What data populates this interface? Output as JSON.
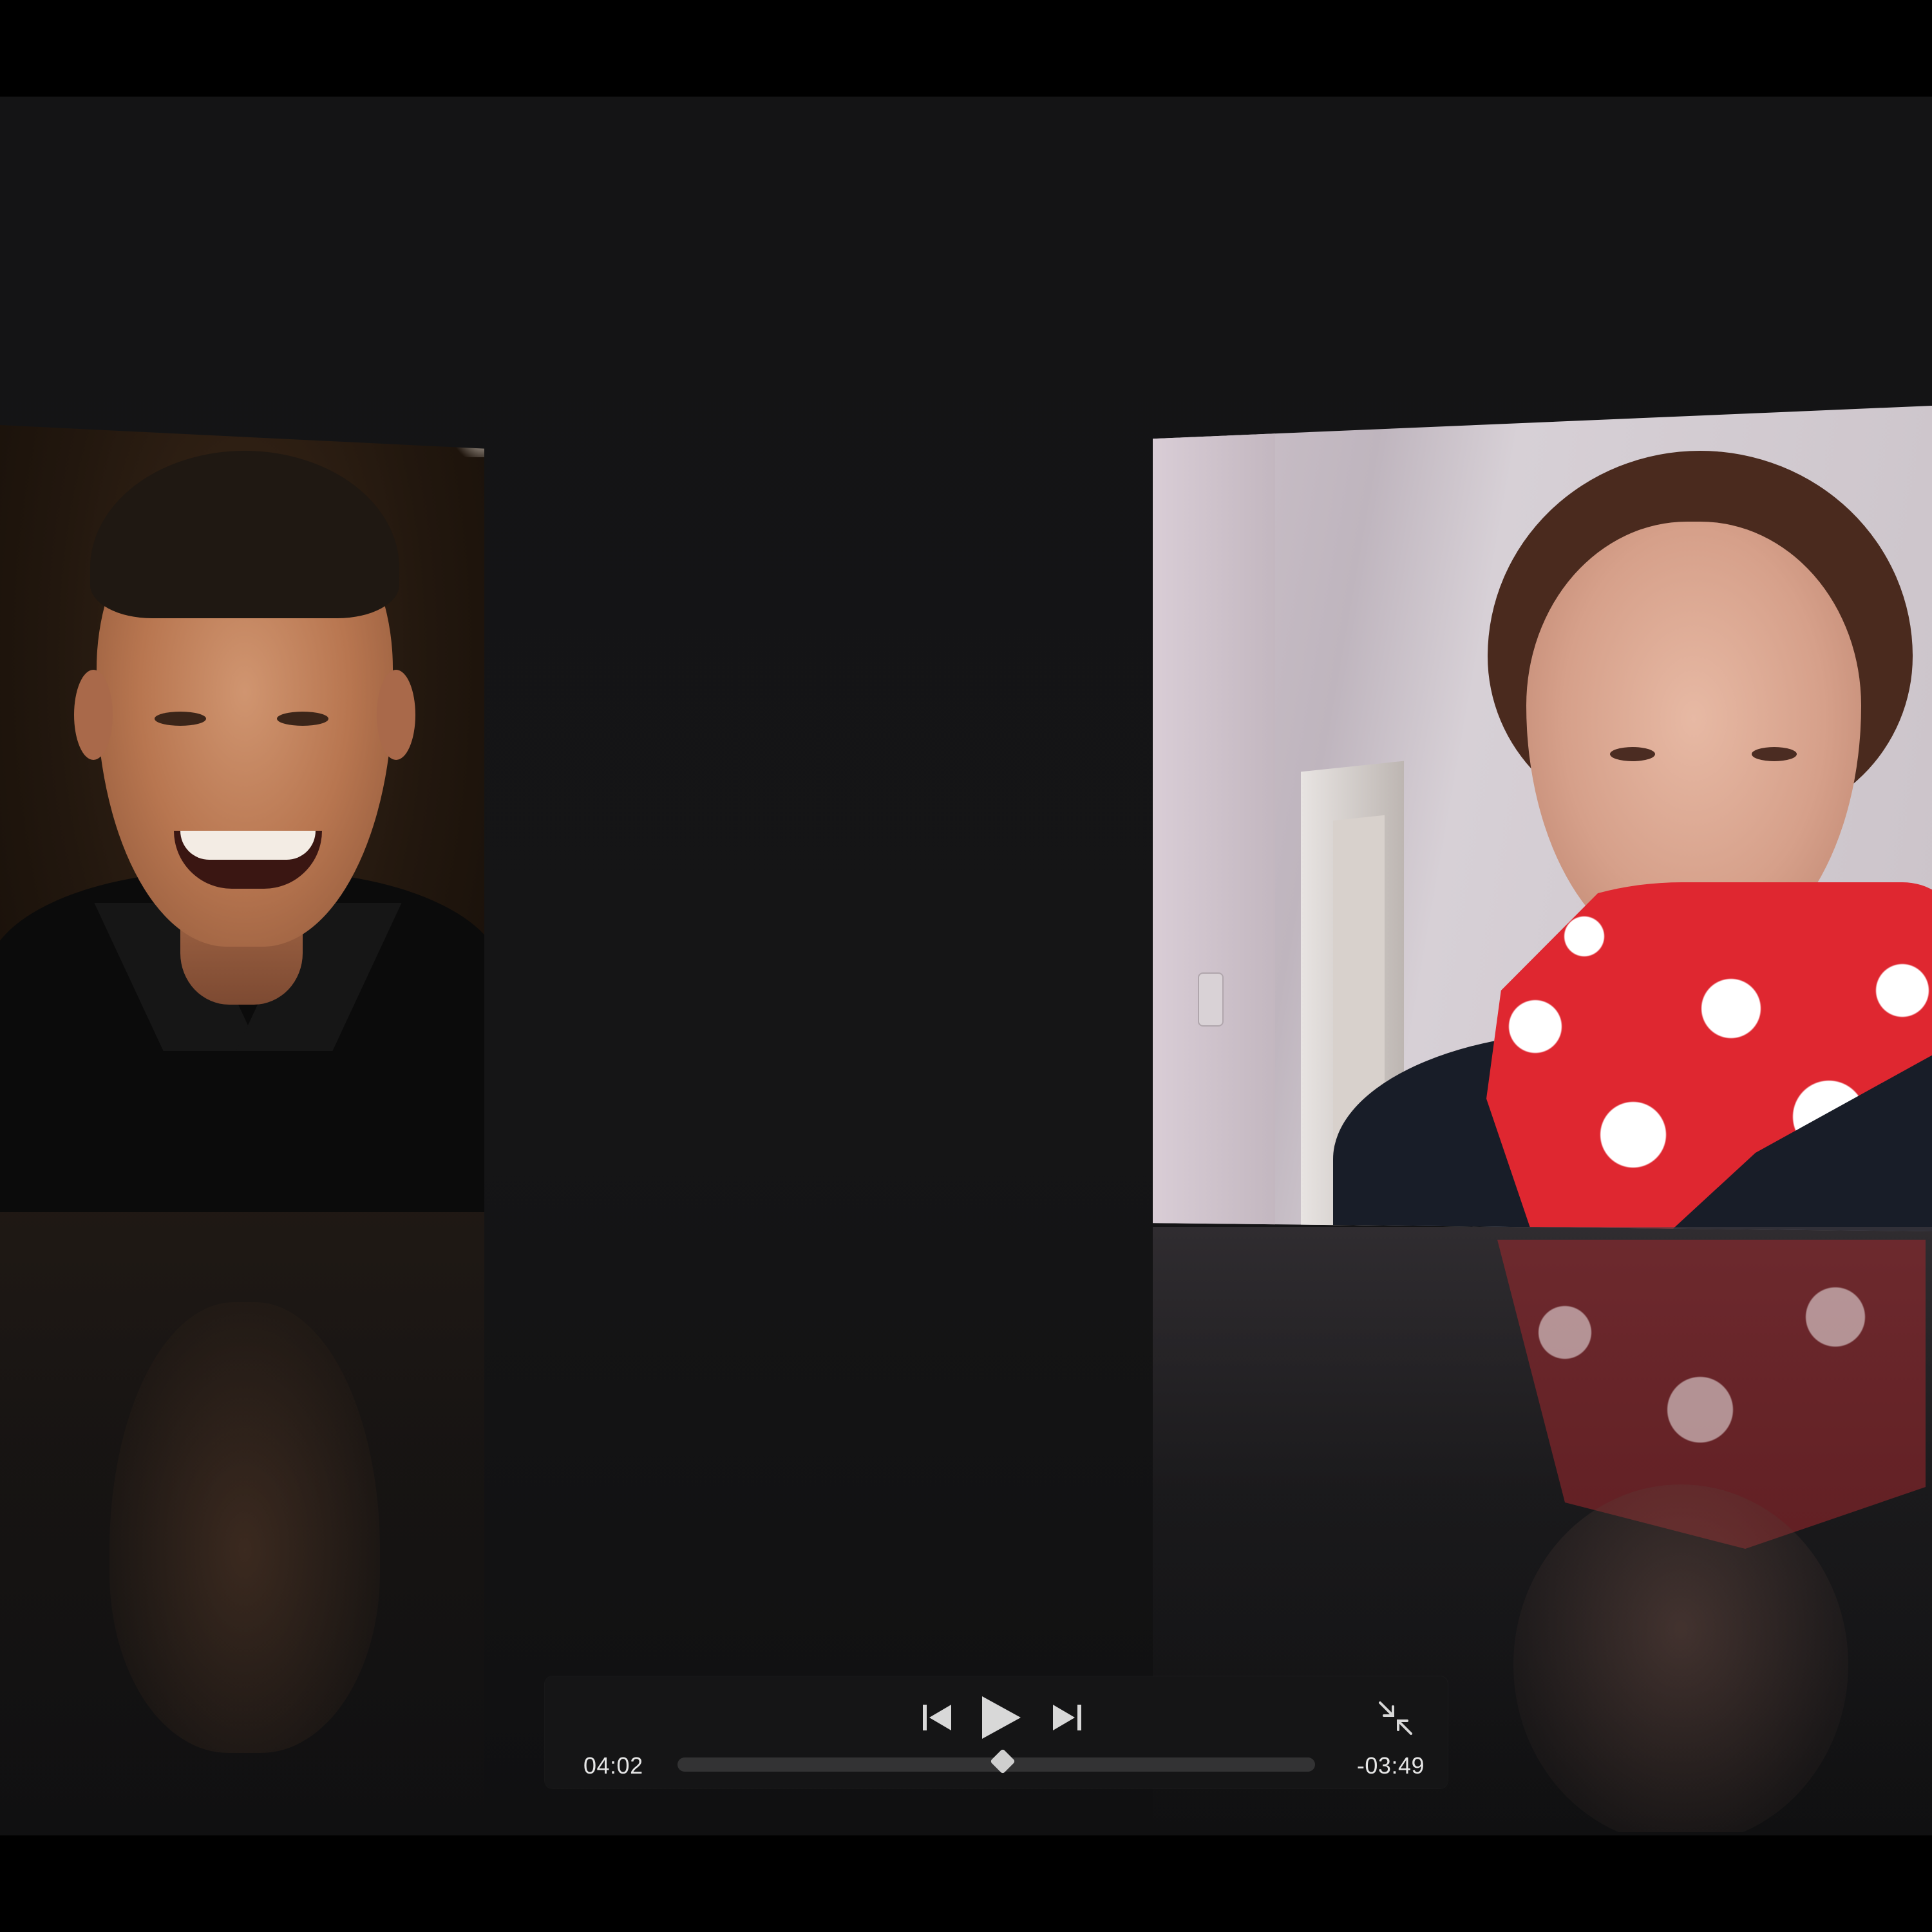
{
  "player": {
    "elapsed_time": "04:02",
    "remaining_time": "-03:49",
    "progress_fraction": 0.51,
    "state": "paused"
  },
  "icons": {
    "previous": "skip-back-icon",
    "play": "play-icon",
    "next": "skip-forward-icon",
    "exit_fullscreen": "exit-fullscreen-icon"
  },
  "colors": {
    "background": "#141415",
    "controls_bg": "#161617",
    "scarf_red": "#df2730"
  }
}
